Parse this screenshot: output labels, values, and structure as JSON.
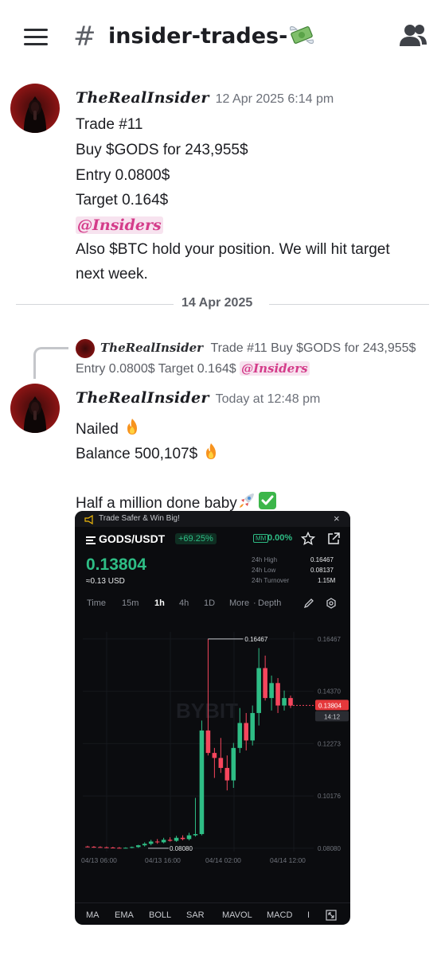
{
  "header": {
    "channel_name": "insider-trades-",
    "money_icon": "money-with-wings",
    "menu_icon": "hamburger-menu",
    "members_icon": "members"
  },
  "message1": {
    "author": "TheRealInsider",
    "timestamp": "12 Apr 2025 6:14 pm",
    "lines": [
      "Trade #11",
      "Buy $GODS for 243,955$",
      "Entry 0.0800$",
      "Target 0.164$"
    ],
    "mention": "@Insiders",
    "last_line_1": "Also $BTC hold your position.  We will hit target",
    "last_line_2": "next week."
  },
  "date_divider": "14 Apr 2025",
  "reply": {
    "author": "TheRealInsider",
    "text_1": "Trade #11 Buy $GODS for 243,955$",
    "text_2": "Entry 0.0800$ Target 0.164$",
    "mention": "@Insiders"
  },
  "message2": {
    "author": "TheRealInsider",
    "timestamp": "Today at 12:48 pm",
    "line1": "Nailed",
    "line2": "Balance 500,107$",
    "line3": "Half a million done baby"
  },
  "trade_card": {
    "banner": "Trade Safer & Win Big!",
    "pair": "GODS/USDT",
    "change_badge": "+69.25%",
    "mm_label": "MM",
    "mm_value": "0.00%",
    "price": "0.13804",
    "price_usd": "≈0.13 USD",
    "stats": [
      {
        "label": "24h High",
        "value": "0.16467"
      },
      {
        "label": "24h Low",
        "value": "0.08137"
      },
      {
        "label": "24h Turnover",
        "value": "1.15M"
      }
    ],
    "timeframes": [
      "Time",
      "15m",
      "1h",
      "4h",
      "1D",
      "More",
      "Depth"
    ],
    "active_timeframe": "1h",
    "indicators": [
      "MA",
      "EMA",
      "BOLL",
      "SAR",
      "MAVOL",
      "MACD",
      "I"
    ],
    "colors": {
      "up": "#2ebd85",
      "down": "#f6465d",
      "bg": "#0b0c0f"
    }
  },
  "chart_data": {
    "type": "candlestick",
    "y_ticks": [
      "0.16467",
      "0.14370",
      "0.12273",
      "0.10176",
      "0.08080"
    ],
    "x_ticks": [
      "04/13 06:00",
      "04/13 16:00",
      "04/14 02:00",
      "04/14 12:00"
    ],
    "high_marker": "0.16467",
    "low_marker": "0.08080",
    "current_price": "0.13804",
    "countdown": "14:12",
    "watermark": "BYBIT",
    "ylim": [
      0.0795,
      0.1675
    ],
    "candles": [
      {
        "o": 0.0815,
        "h": 0.0818,
        "l": 0.0812,
        "c": 0.0814
      },
      {
        "o": 0.0814,
        "h": 0.0817,
        "l": 0.081,
        "c": 0.0813
      },
      {
        "o": 0.0813,
        "h": 0.0816,
        "l": 0.0811,
        "c": 0.0812
      },
      {
        "o": 0.0812,
        "h": 0.0815,
        "l": 0.0809,
        "c": 0.0811
      },
      {
        "o": 0.0811,
        "h": 0.0814,
        "l": 0.0808,
        "c": 0.081
      },
      {
        "o": 0.081,
        "h": 0.0813,
        "l": 0.0808,
        "c": 0.0809
      },
      {
        "o": 0.0809,
        "h": 0.0812,
        "l": 0.0808,
        "c": 0.081
      },
      {
        "o": 0.081,
        "h": 0.0815,
        "l": 0.0808,
        "c": 0.0813
      },
      {
        "o": 0.0813,
        "h": 0.0822,
        "l": 0.081,
        "c": 0.082
      },
      {
        "o": 0.082,
        "h": 0.0832,
        "l": 0.0815,
        "c": 0.0826
      },
      {
        "o": 0.0826,
        "h": 0.0842,
        "l": 0.082,
        "c": 0.0835
      },
      {
        "o": 0.0835,
        "h": 0.0845,
        "l": 0.0826,
        "c": 0.0832
      },
      {
        "o": 0.0832,
        "h": 0.085,
        "l": 0.0828,
        "c": 0.0842
      },
      {
        "o": 0.0842,
        "h": 0.0852,
        "l": 0.0835,
        "c": 0.0838
      },
      {
        "o": 0.0838,
        "h": 0.0858,
        "l": 0.0834,
        "c": 0.085
      },
      {
        "o": 0.085,
        "h": 0.086,
        "l": 0.084,
        "c": 0.0845
      },
      {
        "o": 0.0845,
        "h": 0.087,
        "l": 0.084,
        "c": 0.086
      },
      {
        "o": 0.086,
        "h": 0.101,
        "l": 0.0855,
        "c": 0.0865
      },
      {
        "o": 0.0865,
        "h": 0.132,
        "l": 0.086,
        "c": 0.128
      },
      {
        "o": 0.128,
        "h": 0.1647,
        "l": 0.118,
        "c": 0.119
      },
      {
        "o": 0.119,
        "h": 0.121,
        "l": 0.109,
        "c": 0.117
      },
      {
        "o": 0.117,
        "h": 0.125,
        "l": 0.111,
        "c": 0.113
      },
      {
        "o": 0.113,
        "h": 0.118,
        "l": 0.104,
        "c": 0.108
      },
      {
        "o": 0.108,
        "h": 0.123,
        "l": 0.105,
        "c": 0.121
      },
      {
        "o": 0.121,
        "h": 0.137,
        "l": 0.119,
        "c": 0.131
      },
      {
        "o": 0.131,
        "h": 0.135,
        "l": 0.12,
        "c": 0.124
      },
      {
        "o": 0.124,
        "h": 0.138,
        "l": 0.122,
        "c": 0.135
      },
      {
        "o": 0.135,
        "h": 0.161,
        "l": 0.13,
        "c": 0.153
      },
      {
        "o": 0.153,
        "h": 0.158,
        "l": 0.14,
        "c": 0.141
      },
      {
        "o": 0.141,
        "h": 0.15,
        "l": 0.136,
        "c": 0.147
      },
      {
        "o": 0.147,
        "h": 0.149,
        "l": 0.135,
        "c": 0.138
      },
      {
        "o": 0.138,
        "h": 0.144,
        "l": 0.136,
        "c": 0.141
      },
      {
        "o": 0.141,
        "h": 0.142,
        "l": 0.137,
        "c": 0.138
      }
    ]
  }
}
